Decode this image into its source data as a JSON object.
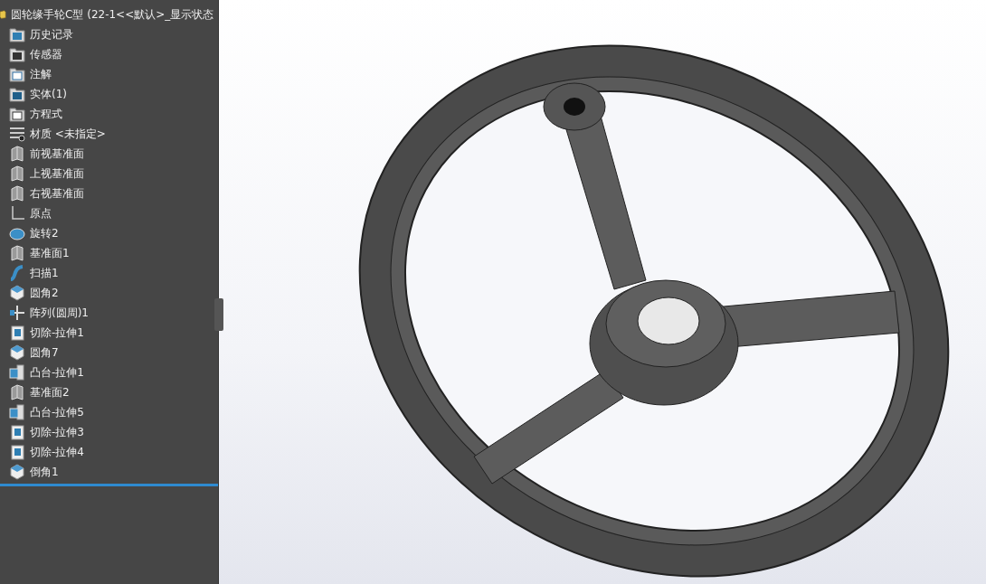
{
  "feature_tree": {
    "root": {
      "label": "圆轮缘手轮C型  (22-1<<默认>_显示状态 ",
      "children": [
        {
          "label": "历史记录",
          "kind": "history"
        },
        {
          "label": "传感器",
          "kind": "sensor"
        },
        {
          "label": "注解",
          "kind": "annotation"
        },
        {
          "label": "实体(1)",
          "kind": "bodies"
        },
        {
          "label": "方程式",
          "kind": "equations"
        },
        {
          "label": "材质 <未指定>",
          "kind": "material"
        },
        {
          "label": "前视基准面",
          "kind": "plane"
        },
        {
          "label": "上视基准面",
          "kind": "plane"
        },
        {
          "label": "右视基准面",
          "kind": "plane"
        },
        {
          "label": "原点",
          "kind": "origin"
        },
        {
          "label": "旋转2",
          "kind": "revolve"
        },
        {
          "label": "基准面1",
          "kind": "plane"
        },
        {
          "label": "扫描1",
          "kind": "sweep"
        },
        {
          "label": "圆角2",
          "kind": "fillet"
        },
        {
          "label": "阵列(圆周)1",
          "kind": "pattern"
        },
        {
          "label": "切除-拉伸1",
          "kind": "cut"
        },
        {
          "label": "圆角7",
          "kind": "fillet"
        },
        {
          "label": "凸台-拉伸1",
          "kind": "boss"
        },
        {
          "label": "基准面2",
          "kind": "plane"
        },
        {
          "label": "凸台-拉伸5",
          "kind": "boss"
        },
        {
          "label": "切除-拉伸3",
          "kind": "cut"
        },
        {
          "label": "切除-拉伸4",
          "kind": "cut"
        },
        {
          "label": "倒角1",
          "kind": "fillet"
        }
      ]
    }
  }
}
